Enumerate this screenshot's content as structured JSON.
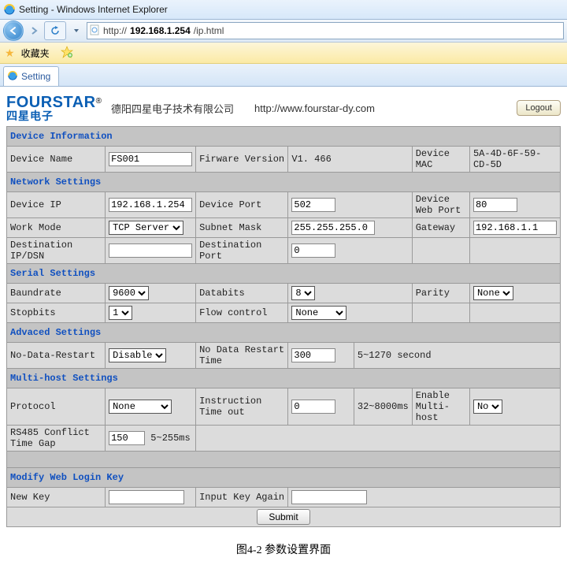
{
  "window": {
    "title": "Setting - Windows Internet Explorer",
    "url_prefix": "http://",
    "url_host": "192.168.1.254",
    "url_path": "/ip.html",
    "fav_label": "收藏夹",
    "tab_label": "Setting"
  },
  "brand": {
    "en": "FOURSTAR",
    "reg": "®",
    "cn": "四星电子",
    "company": "德阳四星电子技术有限公司",
    "site": "http://www.fourstar-dy.com",
    "logout": "Logout"
  },
  "sections": {
    "dev_info": "Device Information",
    "net": "Network Settings",
    "serial": "Serial Settings",
    "adv": "Advaced Settings",
    "multi": "Multi-host Settings",
    "key": "Modify Web Login Key"
  },
  "labels": {
    "device_name": "Device Name",
    "fw_ver": "Firware Version",
    "mac": "Device MAC",
    "device_ip": "Device IP",
    "device_port": "Device Port",
    "web_port": "Device Web Port",
    "work_mode": "Work Mode",
    "subnet": "Subnet Mask",
    "gateway": "Gateway",
    "dest_ip": "Destination IP/DSN",
    "dest_port": "Destination Port",
    "baud": "Baundrate",
    "databits": "Databits",
    "parity": "Parity",
    "stopbits": "Stopbits",
    "flow": "Flow control",
    "nodata": "No-Data-Restart",
    "nodata_time": "No Data Restart Time",
    "nodata_note": "5~1270 second",
    "protocol": "Protocol",
    "instr_to": "Instruction Time out",
    "instr_note": "32~8000ms",
    "en_multi": "Enable Multi-host",
    "rs485_gap": "RS485 Conflict Time Gap",
    "rs485_note": "5~255ms",
    "new_key": "New Key",
    "key_again": "Input Key Again",
    "submit": "Submit"
  },
  "values": {
    "device_name": "FS001",
    "fw_ver": "V1. 466",
    "mac": "5A-4D-6F-59-CD-5D",
    "device_ip": "192.168.1.254",
    "device_port": "502",
    "web_port": "80",
    "work_mode": "TCP Server",
    "subnet": "255.255.255.0",
    "gateway": "192.168.1.1",
    "dest_ip": "",
    "dest_port": "0",
    "baud": "9600",
    "databits": "8",
    "parity": "None",
    "stopbits": "1",
    "flow": "None",
    "nodata": "Disable",
    "nodata_time": "300",
    "protocol": "None",
    "instr_to": "0",
    "en_multi": "No",
    "rs485_gap": "150",
    "new_key": "",
    "key_again": ""
  },
  "caption": "图4-2  参数设置界面"
}
